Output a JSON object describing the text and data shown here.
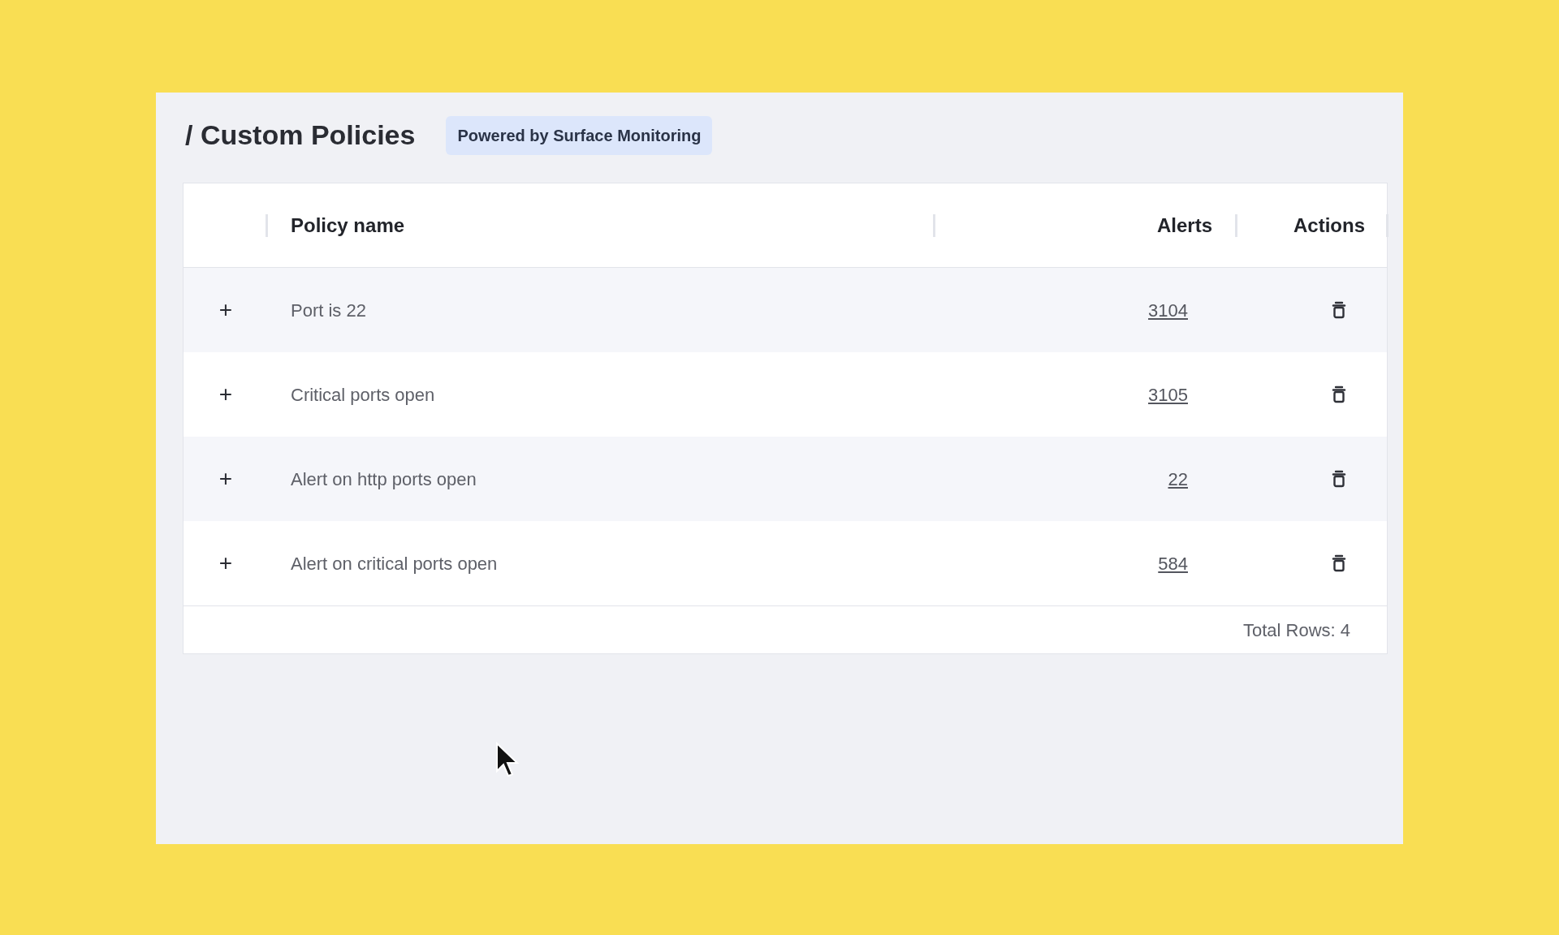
{
  "page": {
    "title": "/ Custom Policies",
    "badge": "Powered by Surface Monitoring"
  },
  "table": {
    "columns": [
      "Policy name",
      "Alerts",
      "Actions"
    ],
    "rows": [
      {
        "expand": "+",
        "policy_name": "Port is 22",
        "alerts": "3104"
      },
      {
        "expand": "+",
        "policy_name": "Critical ports open",
        "alerts": "3105"
      },
      {
        "expand": "+",
        "policy_name": "Alert on http ports open",
        "alerts": "22"
      },
      {
        "expand": "+",
        "policy_name": "Alert on critical ports open",
        "alerts": "584"
      }
    ],
    "footer": "Total Rows: 4"
  }
}
